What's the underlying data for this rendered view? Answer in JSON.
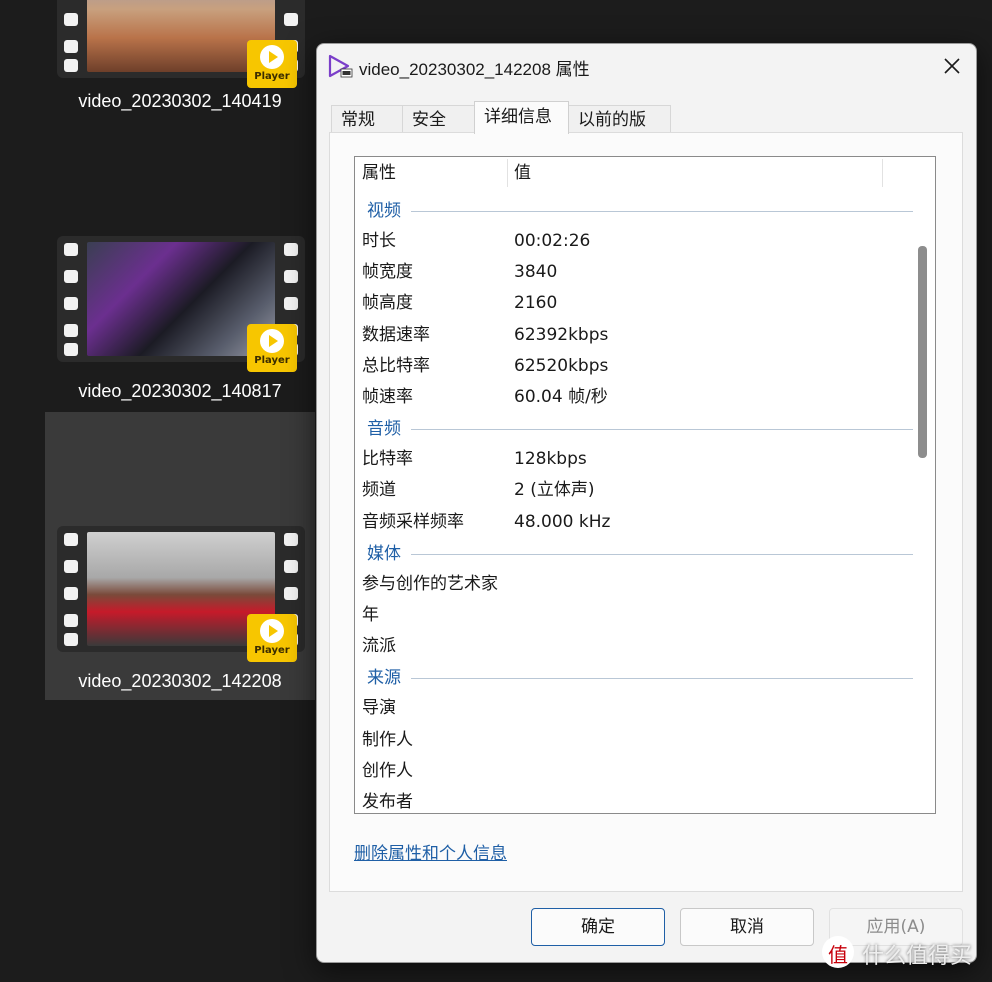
{
  "background": {
    "files": [
      {
        "name": "video_20230302_140419"
      },
      {
        "name": "video_20230302_140817"
      },
      {
        "name": "video_20230302_142208"
      }
    ],
    "badge_label": "Player"
  },
  "dialog": {
    "title": "video_20230302_142208 属性",
    "tabs": [
      {
        "label": "常规",
        "active": false
      },
      {
        "label": "安全",
        "active": false
      },
      {
        "label": "详细信息",
        "active": true
      },
      {
        "label": "以前的版本",
        "active": false
      }
    ],
    "columns": {
      "property": "属性",
      "value": "值"
    },
    "groups": [
      {
        "title": "视频",
        "rows": [
          {
            "name": "时长",
            "value": "00:02:26"
          },
          {
            "name": "帧宽度",
            "value": "3840"
          },
          {
            "name": "帧高度",
            "value": "2160"
          },
          {
            "name": "数据速率",
            "value": "62392kbps"
          },
          {
            "name": "总比特率",
            "value": "62520kbps"
          },
          {
            "name": "帧速率",
            "value": "60.04 帧/秒"
          }
        ]
      },
      {
        "title": "音频",
        "rows": [
          {
            "name": "比特率",
            "value": "128kbps"
          },
          {
            "name": "频道",
            "value": "2 (立体声)"
          },
          {
            "name": "音频采样频率",
            "value": "48.000 kHz"
          }
        ]
      },
      {
        "title": "媒体",
        "rows": [
          {
            "name": "参与创作的艺术家",
            "value": ""
          },
          {
            "name": "年",
            "value": ""
          },
          {
            "name": "流派",
            "value": ""
          }
        ]
      },
      {
        "title": "来源",
        "rows": [
          {
            "name": "导演",
            "value": ""
          },
          {
            "name": "制作人",
            "value": ""
          },
          {
            "name": "创作人",
            "value": ""
          },
          {
            "name": "发布者",
            "value": ""
          }
        ]
      }
    ],
    "remove_link": "删除属性和个人信息",
    "buttons": {
      "ok": "确定",
      "cancel": "取消",
      "apply": "应用(A)"
    }
  },
  "watermark": "什么值得买",
  "colors": {
    "accent": "#1f5fa6",
    "badge": "#f7c600"
  }
}
